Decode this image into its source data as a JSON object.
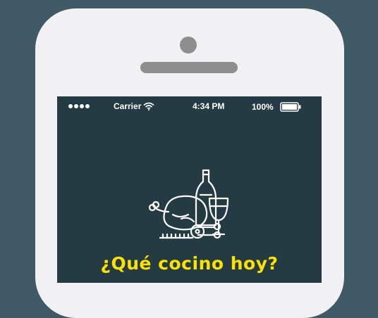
{
  "status_bar": {
    "carrier": "Carrier",
    "time": "4:34 PM",
    "battery": "100%"
  },
  "app": {
    "title": "¿Qué cocino hoy?",
    "logo_icon": "roast-chicken-wine-icon"
  },
  "colors": {
    "background": "#3f5a64",
    "phone_frame": "#f1f1f3",
    "screen": "#243b43",
    "title": "#ffe100"
  }
}
